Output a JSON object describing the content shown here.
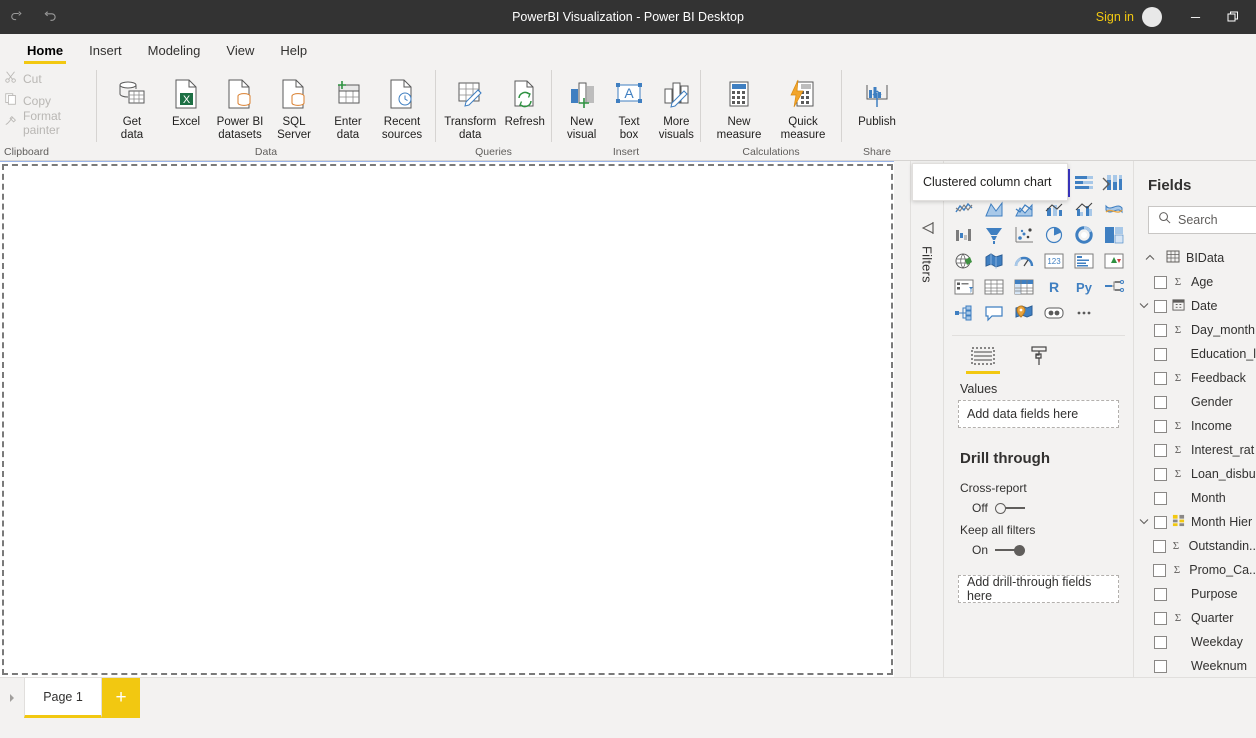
{
  "titlebar": {
    "undo_icon": "undo-icon",
    "redo_icon": "redo-icon",
    "title": "PowerBI Visualization - Power BI Desktop",
    "signin": "Sign in",
    "minimize": "–",
    "restore": "❐"
  },
  "ribbon_tabs": [
    {
      "label": "Home",
      "active": true
    },
    {
      "label": "Insert",
      "active": false
    },
    {
      "label": "Modeling",
      "active": false
    },
    {
      "label": "View",
      "active": false
    },
    {
      "label": "Help",
      "active": false
    }
  ],
  "ribbon": {
    "groups": [
      {
        "name": "Clipboard",
        "label": "Clipboard",
        "small_buttons": [
          {
            "label": "Cut",
            "icon": "scissors-icon"
          },
          {
            "label": "Copy",
            "icon": "copy-icon"
          },
          {
            "label": "Format painter",
            "icon": "format-painter-icon"
          }
        ]
      },
      {
        "name": "Data",
        "label": "Data",
        "buttons": [
          {
            "label": "Get\ndata",
            "icon": "get-data-icon",
            "caret": true
          },
          {
            "label": "Excel",
            "icon": "excel-icon",
            "caret": false
          },
          {
            "label": "Power BI\ndatasets",
            "icon": "powerbi-datasets-icon",
            "caret": false
          },
          {
            "label": "SQL\nServer",
            "icon": "sql-server-icon",
            "caret": false
          },
          {
            "label": "Enter\ndata",
            "icon": "enter-data-icon",
            "caret": false
          },
          {
            "label": "Recent\nsources",
            "icon": "recent-sources-icon",
            "caret": true
          }
        ]
      },
      {
        "name": "Queries",
        "label": "Queries",
        "buttons": [
          {
            "label": "Transform\ndata",
            "icon": "transform-data-icon",
            "caret": true
          },
          {
            "label": "Refresh",
            "icon": "refresh-icon",
            "caret": false
          }
        ]
      },
      {
        "name": "Insert",
        "label": "Insert",
        "buttons": [
          {
            "label": "New\nvisual",
            "icon": "new-visual-icon",
            "caret": false
          },
          {
            "label": "Text\nbox",
            "icon": "text-box-icon",
            "caret": false
          },
          {
            "label": "More\nvisuals",
            "icon": "more-visuals-icon",
            "caret": true
          }
        ]
      },
      {
        "name": "Calculations",
        "label": "Calculations",
        "buttons": [
          {
            "label": "New\nmeasure",
            "icon": "new-measure-icon",
            "caret": false
          },
          {
            "label": "Quick\nmeasure",
            "icon": "quick-measure-icon",
            "caret": false
          }
        ]
      },
      {
        "name": "Share",
        "label": "Share",
        "buttons": [
          {
            "label": "Publish",
            "icon": "publish-icon",
            "caret": false
          }
        ]
      }
    ]
  },
  "filters_pane": {
    "label": "Filters",
    "collapse_icon": "filter-collapse-icon"
  },
  "tooltip": {
    "text": "Clustered column chart"
  },
  "visualizations": {
    "expand_icon": "chevron-right-icon",
    "icons": [
      "stacked-bar-chart",
      "stacked-column-chart",
      "clustered-bar-chart",
      "clustered-column-chart",
      "100-percent-stacked-bar-chart",
      "100-percent-stacked-column-chart",
      "line-chart",
      "area-chart",
      "stacked-area-chart",
      "line-and-stacked-column-chart",
      "line-and-clustered-column-chart",
      "ribbon-chart",
      "waterfall-chart",
      "funnel-chart",
      "scatter-chart",
      "pie-chart",
      "donut-chart",
      "treemap",
      "map",
      "filled-map",
      "gauge",
      "card",
      "multi-row-card",
      "kpi",
      "slicer",
      "table",
      "matrix",
      "r-script-visual",
      "python-visual",
      "decomposition-tree",
      "key-influencers",
      "q-and-a",
      "arcgis-map",
      "paginated-report",
      "more-options"
    ],
    "selected_index": 3,
    "field_tabs": [
      {
        "icon": "fields-pane-icon",
        "active": true
      },
      {
        "icon": "format-paintbrush-icon",
        "active": false
      }
    ],
    "well_label": "Values",
    "well_placeholder": "Add data fields here",
    "drill_through": {
      "title": "Drill through",
      "cross_report_label": "Cross-report",
      "cross_report_state": "Off",
      "keep_filters_label": "Keep all filters",
      "keep_filters_state": "On",
      "drop_placeholder": "Add drill-through fields here"
    }
  },
  "fields": {
    "title": "Fields",
    "search_placeholder": "Search",
    "search_icon": "search-icon",
    "table": {
      "name": "BIData",
      "icon": "table-icon",
      "expanded": true
    },
    "items": [
      {
        "label": "Age",
        "icon": "sigma-icon",
        "expandable": false
      },
      {
        "label": "Date",
        "icon": "calendar-icon",
        "expandable": true
      },
      {
        "label": "Day_month",
        "icon": "sigma-icon",
        "expandable": false
      },
      {
        "label": "Education_l",
        "icon": "",
        "expandable": false
      },
      {
        "label": "Feedback",
        "icon": "sigma-icon",
        "expandable": false
      },
      {
        "label": "Gender",
        "icon": "",
        "expandable": false
      },
      {
        "label": "Income",
        "icon": "sigma-icon",
        "expandable": false
      },
      {
        "label": "Interest_rat",
        "icon": "sigma-icon",
        "expandable": false
      },
      {
        "label": "Loan_disbu",
        "icon": "sigma-icon",
        "expandable": false
      },
      {
        "label": "Month",
        "icon": "",
        "expandable": false
      },
      {
        "label": "Month Hier",
        "icon": "hierarchy-icon",
        "expandable": true
      },
      {
        "label": "Outstandin..",
        "icon": "sigma-icon",
        "expandable": false
      },
      {
        "label": "Promo_Ca..",
        "icon": "sigma-icon",
        "expandable": false
      },
      {
        "label": "Purpose",
        "icon": "",
        "expandable": false
      },
      {
        "label": "Quarter",
        "icon": "sigma-icon",
        "expandable": false
      },
      {
        "label": "Weekday",
        "icon": "",
        "expandable": false
      },
      {
        "label": "Weeknum",
        "icon": "",
        "expandable": false
      }
    ]
  },
  "statusbar": {
    "prev_icon": "page-prev-icon",
    "page_tab": "Page 1",
    "add_page": "+"
  },
  "colors": {
    "accent_yellow": "#f2c811",
    "titlebar": "#333333",
    "ribbon_bg": "#f3f2f1",
    "selection_blue": "#3a36c4",
    "icon_blue": "#3f7fc1",
    "icon_gray": "#7c7c7c"
  }
}
